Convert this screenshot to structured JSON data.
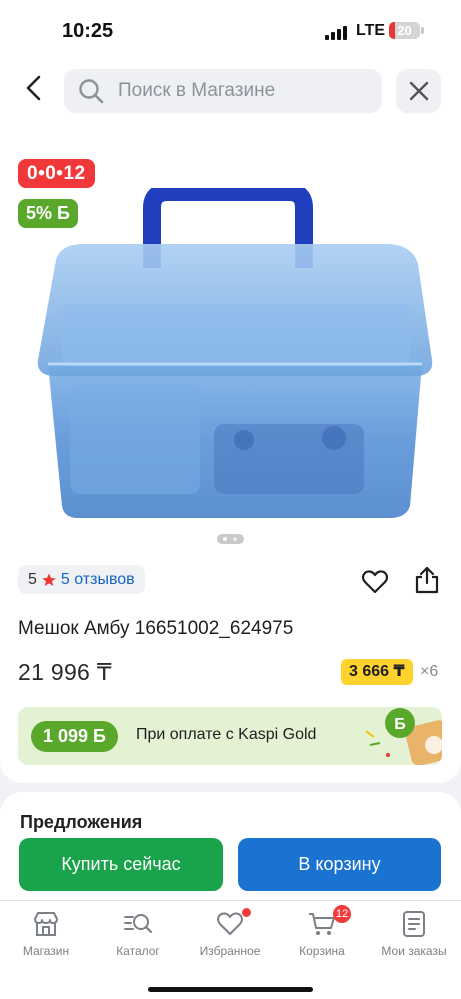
{
  "status_bar": {
    "time": "10:25",
    "network": "LTE",
    "battery": "20",
    "battery_level": 0.2,
    "battery_color": "#e53935"
  },
  "header": {
    "back_icon": "chevron-left-icon",
    "search_placeholder": "Поиск в Магазине",
    "search_icon": "search-icon",
    "close_icon": "close-icon"
  },
  "product": {
    "timer_badge": "0•0•12",
    "bonus_badge": "5% Б",
    "image_description_icon": "plastic-box-product-image",
    "gallery_pages": 2,
    "gallery_current": 1,
    "rating": "5",
    "reviews": "5 отзывов",
    "title": "Мешок Амбу 16651002_624975",
    "price": "21 996 ₸",
    "installment_price": "3 666 ₸",
    "installment_months": "×6",
    "kaspi_bonus": "1 099 Б",
    "kaspi_text": "При оплате с Kaspi Gold",
    "colors": {
      "timer_red": "#f0383a",
      "bonus_green": "#5aa82b",
      "installment_yellow": "#ffd22e",
      "link_blue": "#1565c0"
    }
  },
  "offers": {
    "title": "Предложения",
    "buy_now": "Купить сейчас",
    "add_to_cart": "В корзину",
    "buy_color": "#19a34a",
    "cart_color": "#1a73d0"
  },
  "bottom_nav": {
    "items": [
      {
        "label": "Магазин",
        "icon": "store-icon"
      },
      {
        "label": "Каталог",
        "icon": "catalog-search-icon"
      },
      {
        "label": "Избранное",
        "icon": "heart-icon",
        "dot": true
      },
      {
        "label": "Корзина",
        "icon": "cart-icon",
        "badge": "12"
      },
      {
        "label": "Мои заказы",
        "icon": "orders-icon"
      }
    ]
  }
}
